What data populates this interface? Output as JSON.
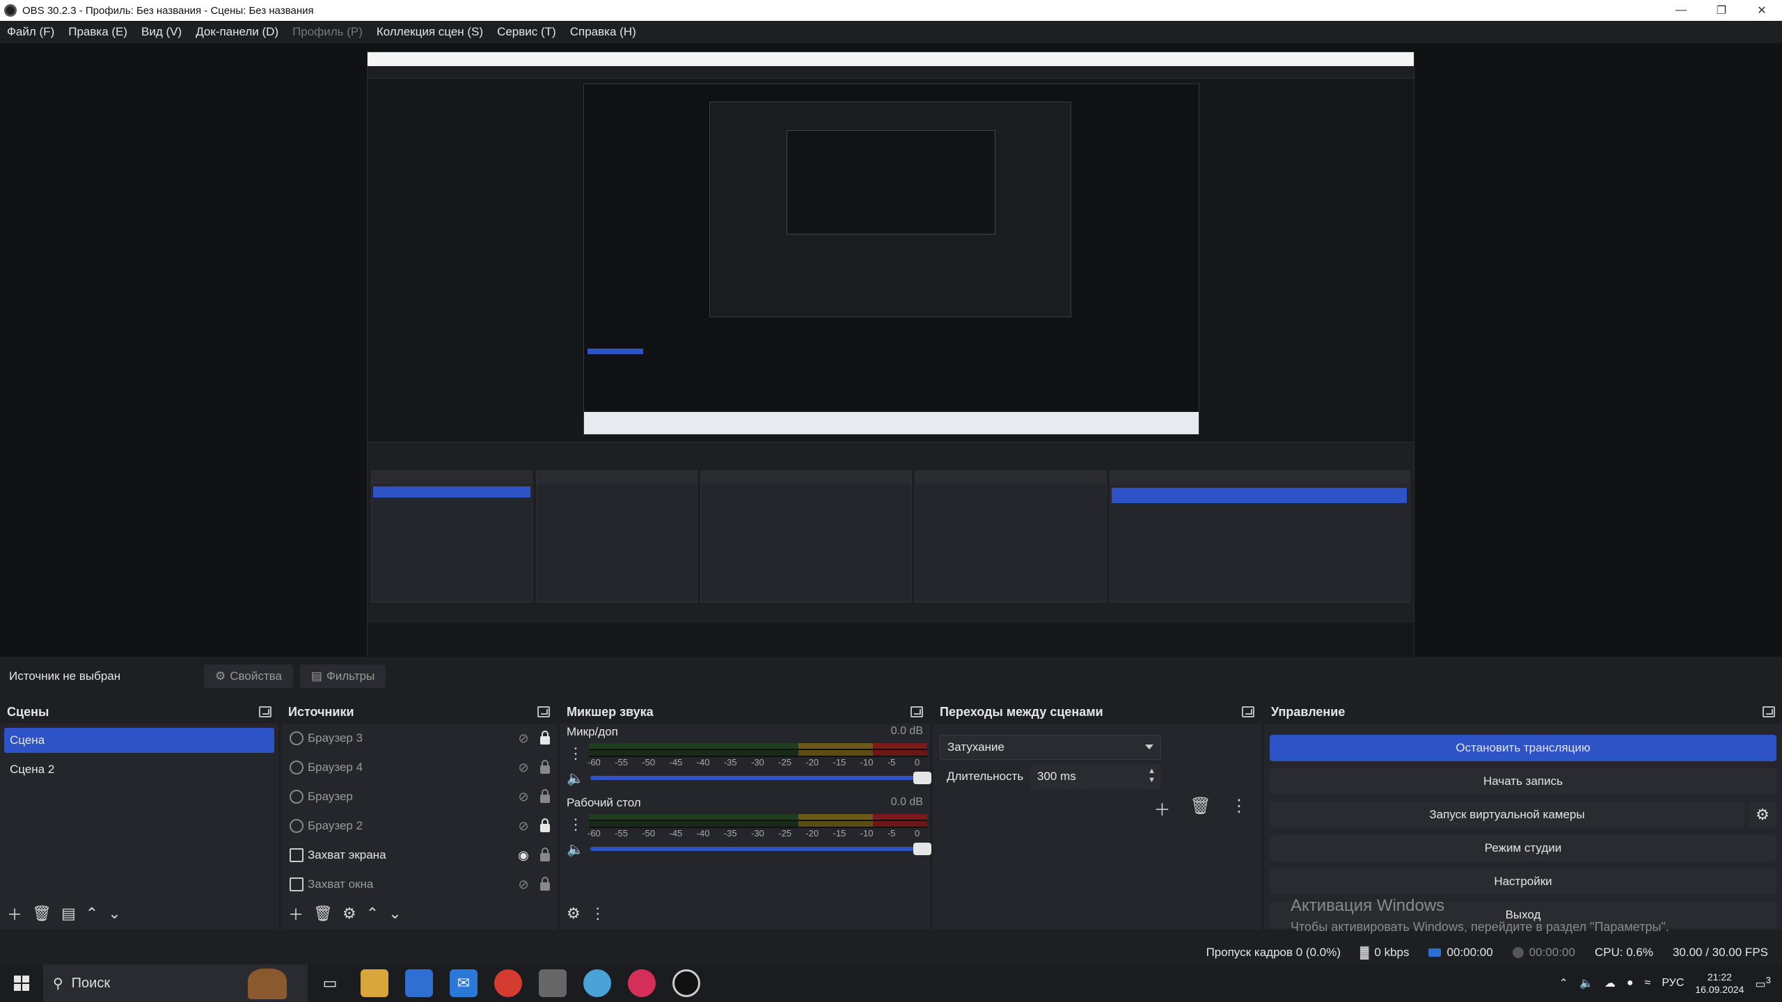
{
  "window": {
    "title": "OBS 30.2.3 - Профиль: Без названия - Сцены: Без названия",
    "controls": [
      "minimize",
      "restore",
      "close"
    ]
  },
  "menu": [
    {
      "label": "Файл (F)",
      "disabled": false
    },
    {
      "label": "Правка (E)",
      "disabled": false
    },
    {
      "label": "Вид (V)",
      "disabled": false
    },
    {
      "label": "Док-панели (D)",
      "disabled": false
    },
    {
      "label": "Профиль (P)",
      "disabled": true
    },
    {
      "label": "Коллекция сцен (S)",
      "disabled": false
    },
    {
      "label": "Сервис (T)",
      "disabled": false
    },
    {
      "label": "Справка (H)",
      "disabled": false
    }
  ],
  "source_toolbar": {
    "no_source": "Источник не выбран",
    "properties_label": "Свойства",
    "filters_label": "Фильтры"
  },
  "scenes": {
    "title": "Сцены",
    "items": [
      {
        "label": "Сцена",
        "selected": true
      },
      {
        "label": "Сцена 2",
        "selected": false
      }
    ]
  },
  "sources": {
    "title": "Источники",
    "items": [
      {
        "label": "Браузер 3",
        "type": "browser",
        "visible": false,
        "locked": true
      },
      {
        "label": "Браузер 4",
        "type": "browser",
        "visible": false,
        "locked": false
      },
      {
        "label": "Браузер",
        "type": "browser",
        "visible": false,
        "locked": false
      },
      {
        "label": "Браузер 2",
        "type": "browser",
        "visible": false,
        "locked": true
      },
      {
        "label": "Захват экрана",
        "type": "monitor",
        "visible": true,
        "locked": false
      },
      {
        "label": "Захват окна",
        "type": "window",
        "visible": false,
        "locked": false
      }
    ]
  },
  "mixer": {
    "title": "Микшер звука",
    "ticks": [
      "-60",
      "-55",
      "-50",
      "-45",
      "-40",
      "-35",
      "-30",
      "-25",
      "-20",
      "-15",
      "-10",
      "-5",
      "0"
    ],
    "channels": [
      {
        "name": "Микр/доп",
        "db": "0.0 dB",
        "volume": 1.0
      },
      {
        "name": "Рабочий стол",
        "db": "0.0 dB",
        "volume": 1.0
      }
    ]
  },
  "transitions": {
    "title": "Переходы между сценами",
    "selected": "Затухание",
    "duration_label": "Длительность",
    "duration_value": "300 ms"
  },
  "controls": {
    "title": "Управление",
    "stop_stream": "Остановить трансляцию",
    "start_record": "Начать запись",
    "virtual_cam": "Запуск виртуальной камеры",
    "studio_mode": "Режим студии",
    "settings": "Настройки",
    "exit": "Выход",
    "watermark_title": "Активация Windows",
    "watermark_text": "Чтобы активировать Windows, перейдите в раздел \"Параметры\"."
  },
  "status": {
    "dropped": "Пропуск кадров 0 (0.0%)",
    "bitrate": "0 kbps",
    "stream_time": "00:00:00",
    "record_time": "00:00:00",
    "cpu": "CPU: 0.6%",
    "fps": "30.00 / 30.00 FPS"
  },
  "taskbar": {
    "search_placeholder": "Поиск",
    "language": "РУС",
    "time": "21:22",
    "date": "16.09.2024",
    "notifications": "3"
  },
  "colors": {
    "accent": "#2d53c7",
    "background": "#1e1f23",
    "dock": "#25262b"
  }
}
